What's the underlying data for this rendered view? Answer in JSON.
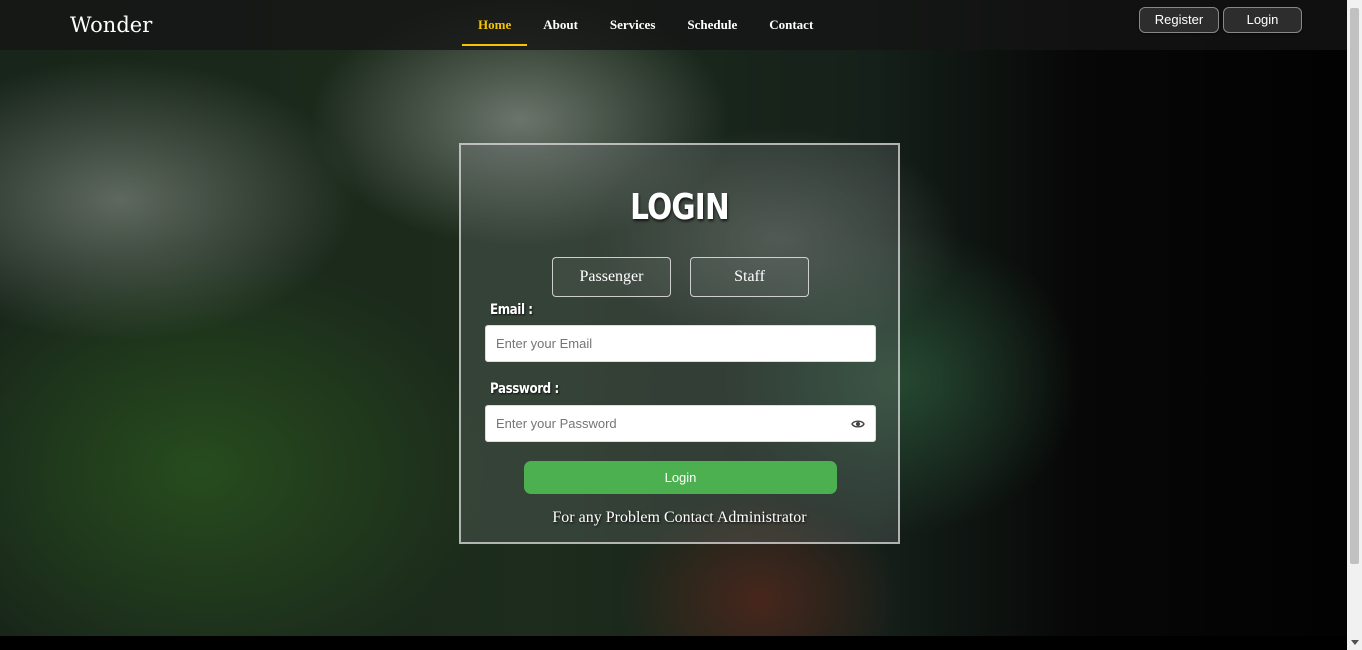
{
  "brand": "Wonder",
  "nav": {
    "links": [
      "Home",
      "About",
      "Services",
      "Schedule",
      "Contact"
    ],
    "active": "Home",
    "active_color": "#f6c400"
  },
  "auth": {
    "register_label": "Register",
    "login_label": "Login"
  },
  "login_card": {
    "title": "LOGIN",
    "roles": [
      "Passenger",
      "Staff"
    ],
    "email_label": "Email :",
    "email_placeholder": "Enter your Email",
    "password_label": "Password :",
    "password_placeholder": "Enter your Password",
    "password_toggle_icon": "eye-icon",
    "submit_label": "Login",
    "submit_color": "#4caf50",
    "help_text": "For any Problem Contact Administrator"
  }
}
